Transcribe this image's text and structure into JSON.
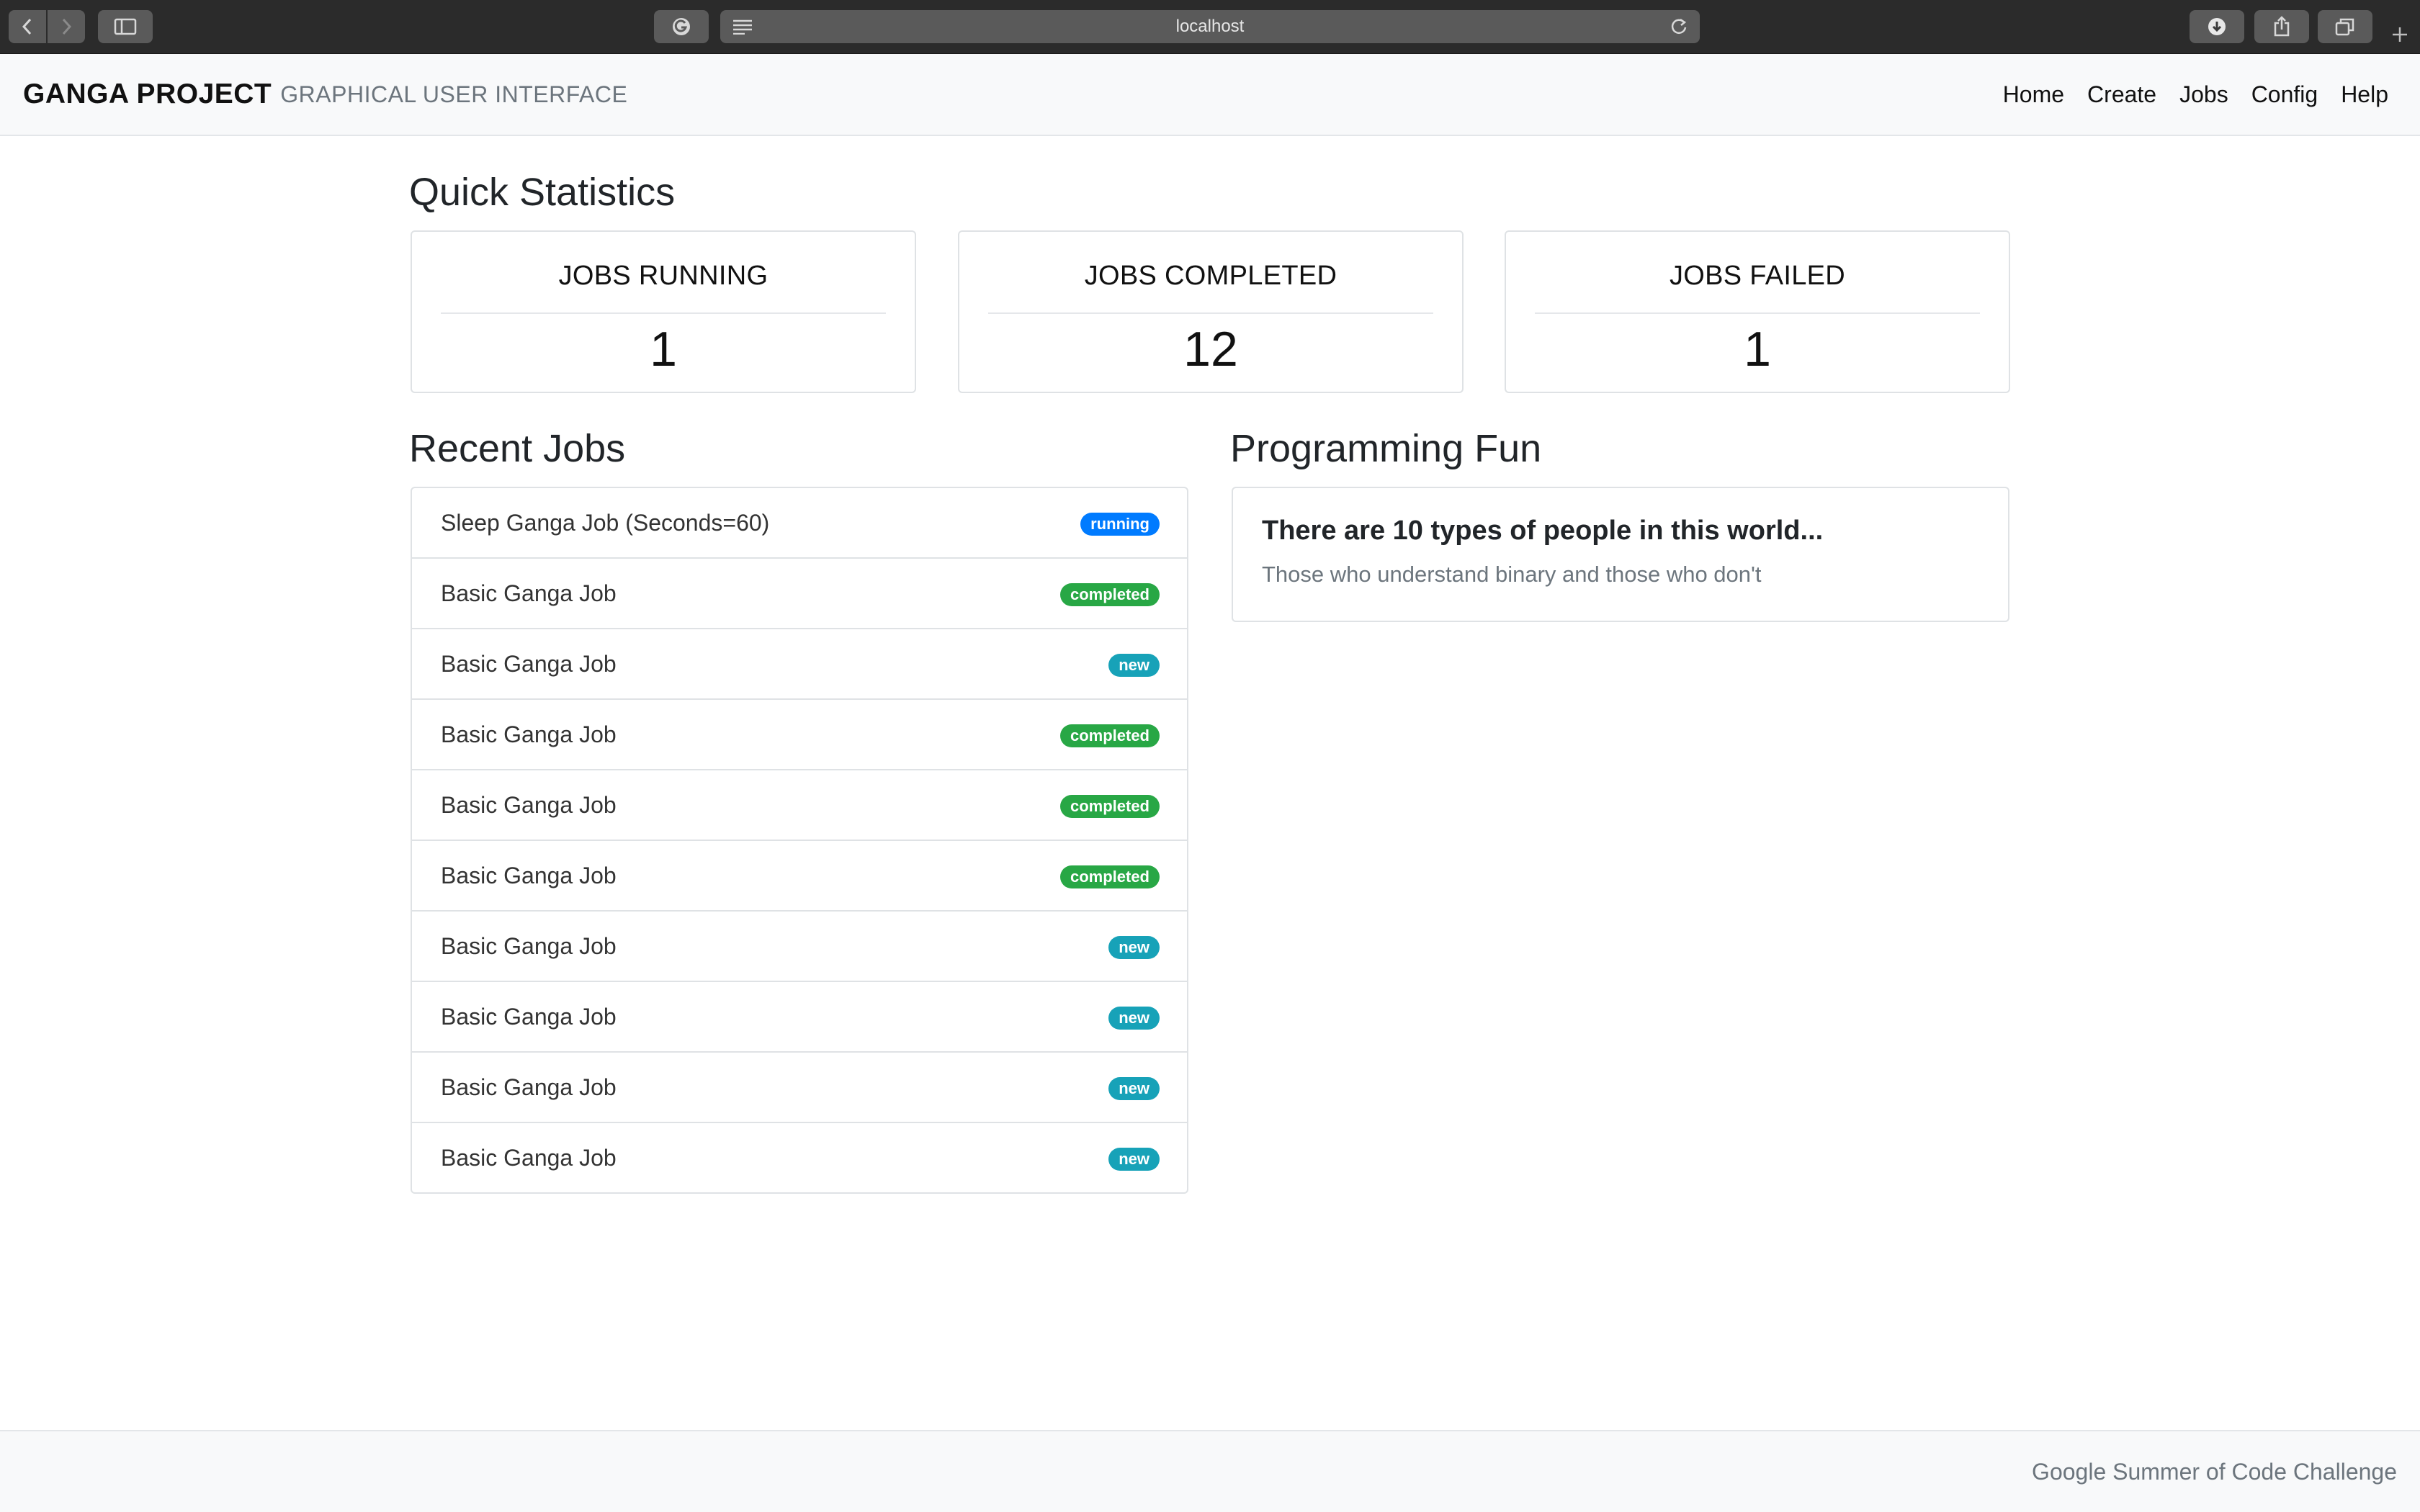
{
  "browser": {
    "url": "localhost",
    "icons": {
      "back": "chevron-left-icon",
      "forward": "chevron-right-icon",
      "sidebar": "sidebar-icon",
      "extension": "grammarly-icon",
      "reader": "reader-icon",
      "reload": "reload-icon",
      "download": "download-icon",
      "share": "share-icon",
      "tabs": "tabs-icon",
      "new_tab": "plus-icon"
    }
  },
  "navbar": {
    "brand": "GANGA PROJECT",
    "subtitle": "GRAPHICAL USER INTERFACE",
    "links": [
      "Home",
      "Create",
      "Jobs",
      "Config",
      "Help"
    ]
  },
  "stats": {
    "title": "Quick Statistics",
    "cards": [
      {
        "label": "JOBS RUNNING",
        "value": "1"
      },
      {
        "label": "JOBS COMPLETED",
        "value": "12"
      },
      {
        "label": "JOBS FAILED",
        "value": "1"
      }
    ]
  },
  "recent": {
    "title": "Recent Jobs",
    "jobs": [
      {
        "name": "Sleep Ganga Job (Seconds=60)",
        "status": "running"
      },
      {
        "name": "Basic Ganga Job",
        "status": "completed"
      },
      {
        "name": "Basic Ganga Job",
        "status": "new"
      },
      {
        "name": "Basic Ganga Job",
        "status": "completed"
      },
      {
        "name": "Basic Ganga Job",
        "status": "completed"
      },
      {
        "name": "Basic Ganga Job",
        "status": "completed"
      },
      {
        "name": "Basic Ganga Job",
        "status": "new"
      },
      {
        "name": "Basic Ganga Job",
        "status": "new"
      },
      {
        "name": "Basic Ganga Job",
        "status": "new"
      },
      {
        "name": "Basic Ganga Job",
        "status": "new"
      }
    ]
  },
  "fun": {
    "title": "Programming Fun",
    "heading": "There are 10 types of people in this world...",
    "text": "Those who understand binary and those who don't"
  },
  "footer": {
    "text": "Google Summer of Code Challenge"
  },
  "colors": {
    "running": "#007bff",
    "completed": "#28a745",
    "new": "#17a2b8"
  }
}
